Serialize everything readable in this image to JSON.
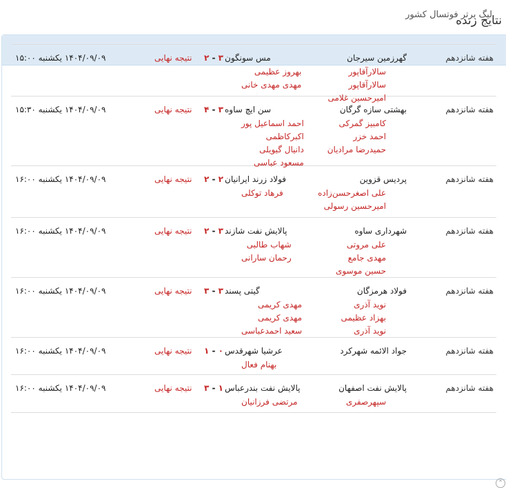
{
  "page": {
    "title": "نتایج زنده"
  },
  "league": {
    "title": "لیگ برتر فوتسال کشور"
  },
  "matches": [
    {
      "week": "هفته شانزدهم",
      "home": "گهرزمین سیرجان",
      "home_goals": "۳",
      "away_goals": "۲",
      "away": "مس سونگون",
      "status": "نتیجه نهایی",
      "datetime": "۱۴۰۴/۰۹/۰۹ یکشنبه ۱۵:۰۰",
      "home_scorers": [
        "سالارآقاپور",
        "سالارآقاپور",
        "امیرحسین غلامی"
      ],
      "away_scorers": [
        "بهروز عظیمی",
        "مهدی مهدی خانی"
      ]
    },
    {
      "week": "هفته شانزدهم",
      "home": "بهشتی سازه گرگان",
      "home_goals": "۳",
      "away_goals": "۴",
      "away": "سن ایچ ساوه",
      "status": "نتیجه نهایی",
      "datetime": "۱۴۰۴/۰۹/۰۹ یکشنبه ۱۵:۳۰",
      "home_scorers": [
        "کامبیز گمرکی",
        "احمد خزر",
        "حمیدرضا مرادیان"
      ],
      "away_scorers": [
        "احمد اسماعیل پور",
        "اکبرکاظمی",
        "دانیال گیویلی",
        "مسعود عباسی"
      ]
    },
    {
      "week": "هفته شانزدهم",
      "home": "پردیس قزوین",
      "home_goals": "۲",
      "away_goals": "۲",
      "away": "فولاد زرند ایرانیان",
      "status": "نتیجه نهایی",
      "datetime": "۱۴۰۴/۰۹/۰۹ یکشنبه ۱۶:۰۰",
      "home_scorers": [
        "علی اصغرحسن‌زاده",
        "امیرحسین رسولی"
      ],
      "away_scorers": [
        "فرهاد توکلی"
      ]
    },
    {
      "week": "هفته شانزدهم",
      "home": "شهرداری ساوه",
      "home_goals": "۳",
      "away_goals": "۲",
      "away": "پالایش نفت شازند",
      "status": "نتیجه نهایی",
      "datetime": "۱۴۰۴/۰۹/۰۹ یکشنبه ۱۶:۰۰",
      "home_scorers": [
        "علی مروتی",
        "مهدی جامع",
        "حسین موسوی"
      ],
      "away_scorers": [
        "شهاب طالبی",
        "رحمان سارانی"
      ]
    },
    {
      "week": "هفته شانزدهم",
      "home": "فولاد هرمزگان",
      "home_goals": "۳",
      "away_goals": "۳",
      "away": "گیتی پسند",
      "status": "نتیجه نهایی",
      "datetime": "۱۴۰۴/۰۹/۰۹ یکشنبه ۱۶:۰۰",
      "home_scorers": [
        "نوید آذری",
        "بهزاد عظیمی",
        "نوید آذری"
      ],
      "away_scorers": [
        "مهدی کریمی",
        "مهدی کریمی",
        "سعید احمدعباسی"
      ]
    },
    {
      "week": "هفته شانزدهم",
      "home": "جواد الائمه شهرکرد",
      "home_goals": "۰",
      "away_goals": "۱",
      "away": "عرشیا شهرقدس",
      "status": "نتیجه نهایی",
      "datetime": "۱۴۰۴/۰۹/۰۹ یکشنبه ۱۶:۰۰",
      "home_scorers": [],
      "away_scorers": [
        "بهنام فعال"
      ]
    },
    {
      "week": "هفته شانزدهم",
      "home": "پالایش نفت اصفهان",
      "home_goals": "۱",
      "away_goals": "۳",
      "away": "پالایش نفت بندرعباس",
      "status": "نتیجه نهایی",
      "datetime": "۱۴۰۴/۰۹/۰۹ یکشنبه ۱۶:۰۰",
      "home_scorers": [
        "سپهرصفری"
      ],
      "away_scorers": [
        "مرتضی فرزانیان"
      ]
    }
  ]
}
